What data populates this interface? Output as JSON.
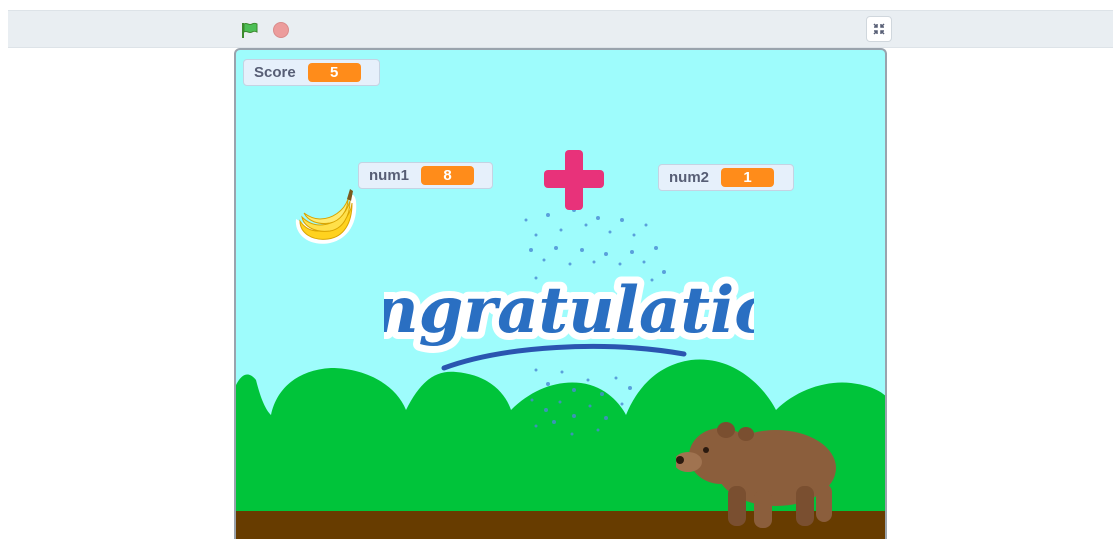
{
  "toolbar": {
    "green_flag_icon": "green-flag-icon",
    "stop_icon": "stop-icon",
    "fullscreen_icon": "exit-fullscreen-icon"
  },
  "monitors": {
    "score": {
      "label": "Score",
      "value": "5"
    },
    "num1": {
      "label": "num1",
      "value": "8"
    },
    "num2": {
      "label": "num2",
      "value": "1"
    }
  },
  "stage": {
    "banner_text": "Congratulations",
    "sprites": [
      "banana",
      "plus-sign",
      "bear"
    ],
    "colors": {
      "sky": "#9efcfc",
      "hills": "#00c43a",
      "ground": "#673c00",
      "monitor_value": "#ff8c1a",
      "plus": "#e8327a"
    }
  }
}
